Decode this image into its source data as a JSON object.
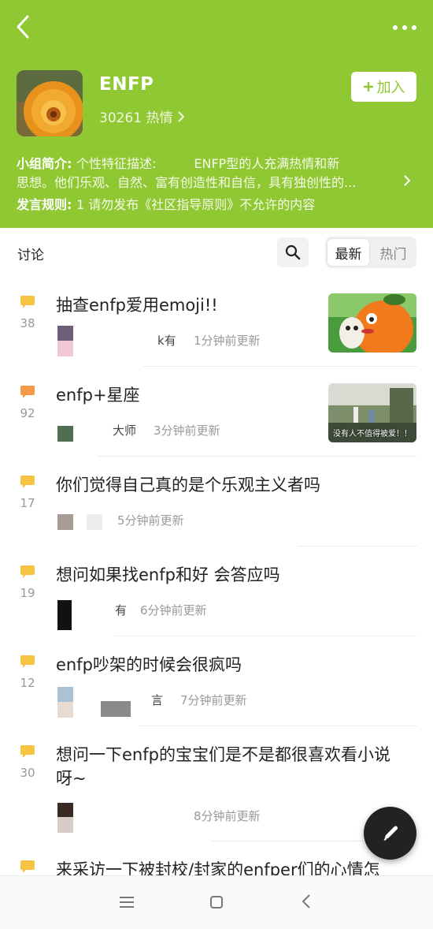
{
  "header": {
    "group_name": "ENFP",
    "heat": "30261 热情",
    "join_label": "加入",
    "intro_label": "小组简介",
    "intro_line1": "个性特征描述:　　　ENFP型的人充满热情和新",
    "intro_line2": "思想。他们乐观、自然、富有创造性和自信，具有独创性的...",
    "rules_label": "发言规则",
    "rules_text": "1 请勿发布《社区指导原则》不允许的内容"
  },
  "toolbar": {
    "title": "讨论",
    "tab_new": "最新",
    "tab_hot": "热门"
  },
  "posts": [
    {
      "count": "38",
      "title": "抽查enfp爱用emoji!!",
      "author": "k有",
      "time": "1分钟前更新"
    },
    {
      "count": "92",
      "title": "enfp+星座",
      "author": "大师",
      "time": "3分钟前更新"
    },
    {
      "count": "17",
      "title": "你们觉得自己真的是个乐观主义者吗",
      "author": "",
      "time": "5分钟前更新"
    },
    {
      "count": "19",
      "title": "想问如果找enfp和好 会答应吗",
      "author": "有",
      "time": "6分钟前更新"
    },
    {
      "count": "12",
      "title": "enfp吵架的时候会很疯吗",
      "author": "言",
      "time": "7分钟前更新"
    },
    {
      "count": "30",
      "title_line1": "想问一下enfp的宝宝们是不是都很喜欢看小说",
      "title_line2": "呀~",
      "author": "",
      "time": "8分钟前更新"
    },
    {
      "count": "",
      "title": "来采访一下被封校/封家的enfper们的心情怎"
    }
  ],
  "thumbs": {
    "post1_caption": "",
    "post2_caption": "没有人不值得被爱！！"
  },
  "colors": {
    "brand": "#8fc832",
    "comment_icon": "#f6c343"
  }
}
